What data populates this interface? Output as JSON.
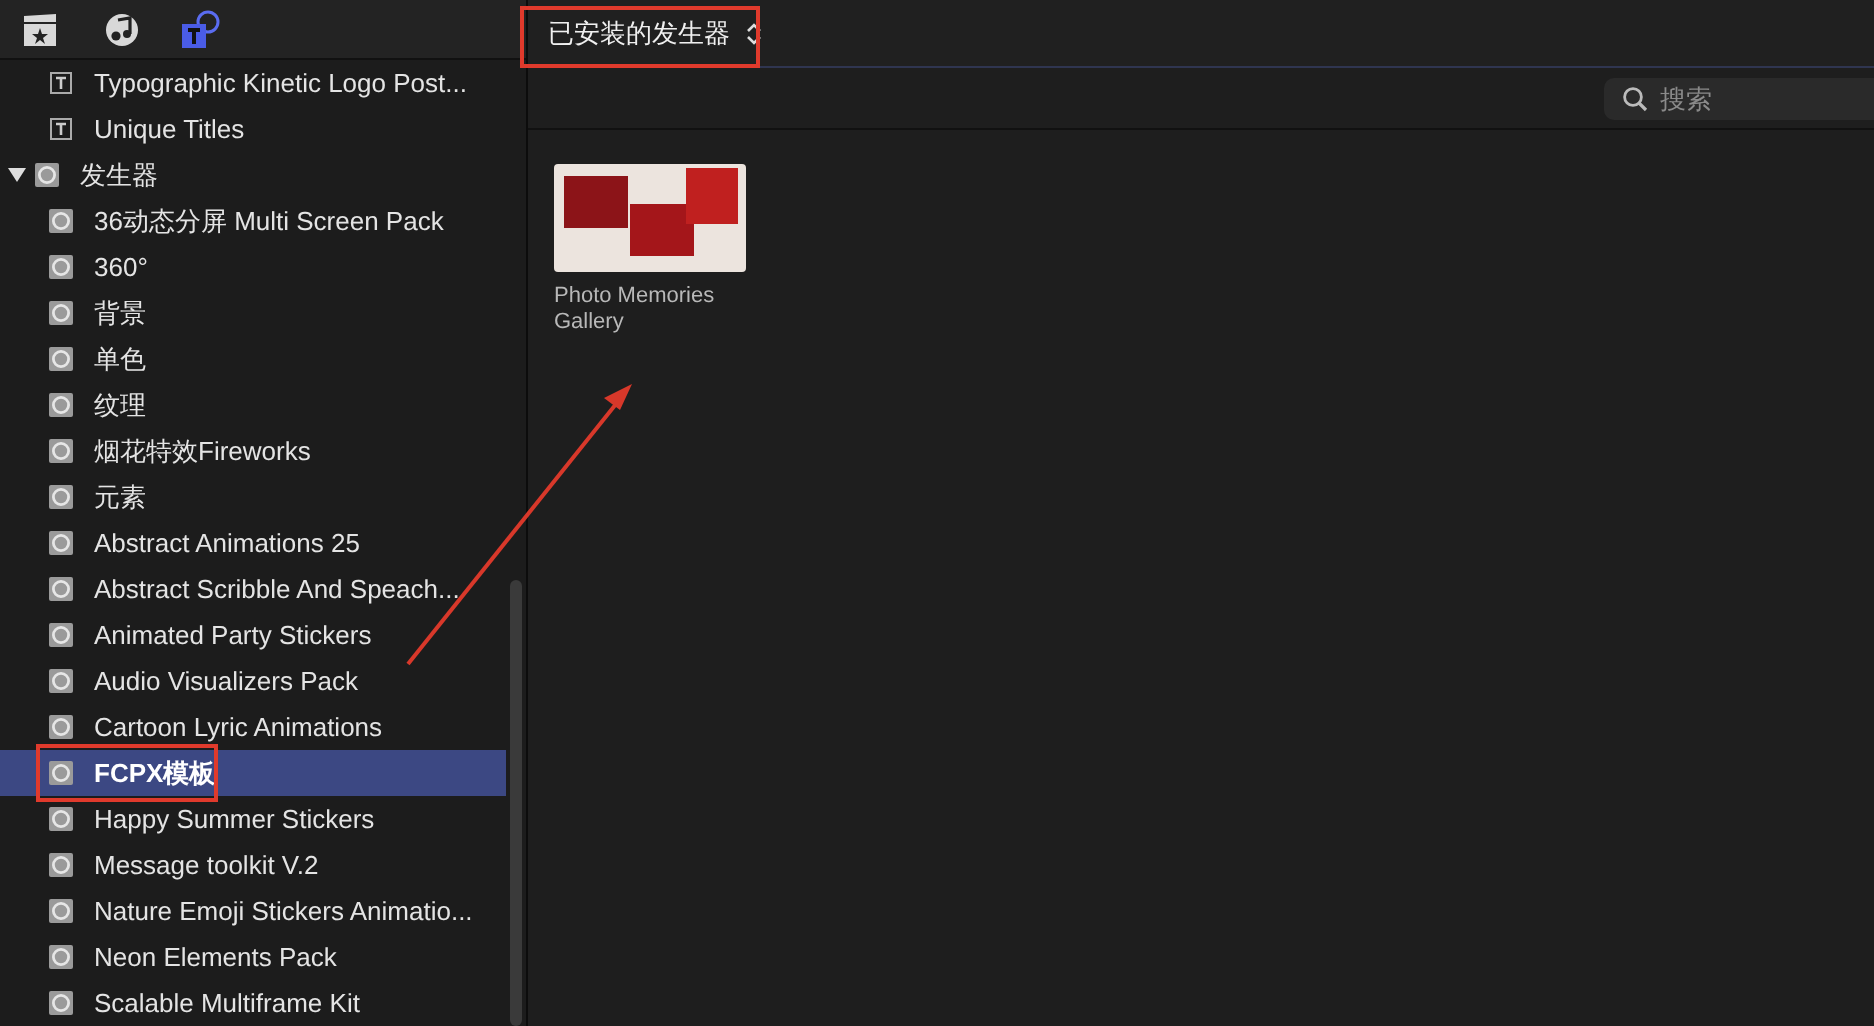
{
  "toolbar": {
    "tabs": [
      {
        "kind": "clapboard",
        "selected": false
      },
      {
        "kind": "music",
        "selected": false
      },
      {
        "kind": "titles",
        "selected": true
      }
    ]
  },
  "sidebar": {
    "items": [
      {
        "label": "Typographic Kinetic Logo Post...",
        "kind": "title",
        "selected": false
      },
      {
        "label": "Unique Titles",
        "kind": "title",
        "selected": false
      },
      {
        "label": "发生器",
        "kind": "generator",
        "expanded": true,
        "selected": false,
        "children": [
          {
            "label": "36动态分屏 Multi Screen Pack",
            "kind": "generator",
            "selected": false
          },
          {
            "label": "360°",
            "kind": "generator",
            "selected": false
          },
          {
            "label": "背景",
            "kind": "generator",
            "selected": false
          },
          {
            "label": "单色",
            "kind": "generator",
            "selected": false
          },
          {
            "label": "纹理",
            "kind": "generator",
            "selected": false
          },
          {
            "label": "烟花特效Fireworks",
            "kind": "generator",
            "selected": false
          },
          {
            "label": "元素",
            "kind": "generator",
            "selected": false
          },
          {
            "label": "Abstract Animations 25",
            "kind": "generator",
            "selected": false
          },
          {
            "label": "Abstract Scribble And Speach...",
            "kind": "generator",
            "selected": false
          },
          {
            "label": "Animated Party Stickers",
            "kind": "generator",
            "selected": false
          },
          {
            "label": "Audio Visualizers Pack",
            "kind": "generator",
            "selected": false
          },
          {
            "label": "Cartoon Lyric Animations",
            "kind": "generator",
            "selected": false
          },
          {
            "label": "FCPX模板",
            "kind": "generator",
            "selected": true
          },
          {
            "label": "Happy Summer Stickers",
            "kind": "generator",
            "selected": false
          },
          {
            "label": "Message toolkit V.2",
            "kind": "generator",
            "selected": false
          },
          {
            "label": "Nature Emoji Stickers Animatio...",
            "kind": "generator",
            "selected": false
          },
          {
            "label": "Neon Elements Pack",
            "kind": "generator",
            "selected": false
          },
          {
            "label": "Scalable Multiframe Kit",
            "kind": "generator",
            "selected": false
          }
        ]
      }
    ]
  },
  "browser": {
    "filter": "已安装的发生器",
    "search": {
      "placeholder": "搜索"
    },
    "clips": [
      {
        "title": "Photo Memories Gallery"
      }
    ]
  }
}
